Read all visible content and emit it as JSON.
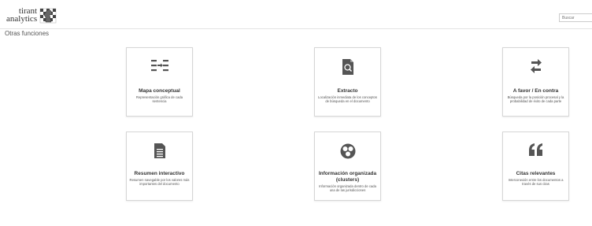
{
  "header": {
    "logo_line1": "tirant",
    "logo_line2": "analytics",
    "search_placeholder": "Buscar"
  },
  "page_title": "Otras funciones",
  "cards": [
    {
      "title": "Mapa conceptual",
      "desc": "Representación gráfica de cada sentencia",
      "icon": "concept-map-icon"
    },
    {
      "title": "Extracto",
      "desc": "Localización inmediata de los conceptos de búsqueda en el documento",
      "icon": "search-document-icon"
    },
    {
      "title": "A favor / En contra",
      "desc": "Búsqueda por la posición procesal y la probabilidad de éxito de cada parte",
      "icon": "exchange-arrows-icon"
    },
    {
      "title": "Resumen interactivo",
      "desc": "Resumen navegable por los valores más importantes del documento",
      "icon": "document-list-icon"
    },
    {
      "title": "Información organizada (clusters)",
      "desc": "Información organizada dentro de cada una de las jurisdicciones",
      "icon": "clusters-icon"
    },
    {
      "title": "Citas relevantes",
      "desc": "Interconexión entre los documentos a través de sus citas",
      "icon": "quote-icon"
    }
  ]
}
